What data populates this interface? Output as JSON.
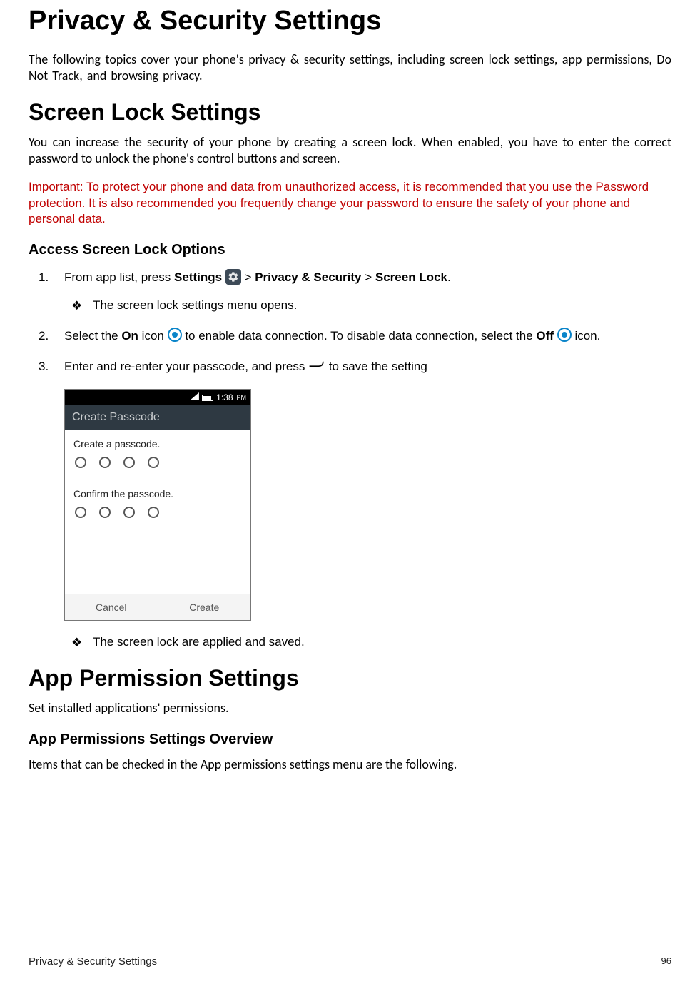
{
  "title": "Privacy & Security Settings",
  "intro": "The following topics cover your phone's privacy & security settings, including screen lock settings, app permissions, Do Not Track, and browsing privacy.",
  "screen_lock": {
    "heading": "Screen Lock Settings",
    "body": "You can increase the security of your phone by creating a screen lock. When enabled, you have to enter the correct password to unlock the phone's control buttons and screen.",
    "important_label": "Important",
    "important_text": ": To protect your phone and data from unauthorized access, it is recommended that you use the Password protection. It is also recommended you frequently change your password to ensure the safety of your phone and personal data.",
    "access_heading": "Access Screen Lock Options",
    "step1_a": "From app list, press ",
    "step1_settings": "Settings",
    "step1_b": " > ",
    "step1_privacy": "Privacy & Security",
    "step1_c": " > ",
    "step1_screenlock": "Screen Lock",
    "step1_d": ".",
    "bullet1": "The screen lock settings menu opens.",
    "step2_a": "Select the ",
    "step2_on": "On",
    "step2_b": " icon ",
    "step2_c": " to enable data connection. To disable data connection, select the ",
    "step2_off": "Off",
    "step2_d": " icon.",
    "step3_a": "Enter and re-enter your passcode, and press ",
    "step3_b": " to save the setting",
    "bullet2": "The screen lock are applied and saved."
  },
  "phone": {
    "time": "1:38",
    "ampm": "PM",
    "header": "Create Passcode",
    "label1": "Create a passcode.",
    "label2": "Confirm the passcode.",
    "cancel": "Cancel",
    "create": "Create"
  },
  "app_perm": {
    "heading": "App Permission Settings",
    "body": "Set installed applications' permissions.",
    "overview_heading": "App Permissions Settings Overview",
    "overview_body": "Items that can be checked in the App permissions settings menu are the following."
  },
  "footer": {
    "section": "Privacy & Security Settings",
    "page": "96"
  }
}
